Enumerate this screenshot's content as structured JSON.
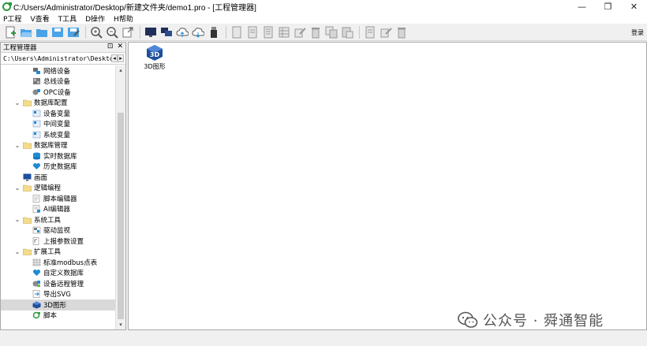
{
  "window": {
    "title": "C:/Users/Administrator/Desktop/新建文件夹/demo1.pro - [工程管理器]",
    "controls": {
      "minimize": "—",
      "maximize": "❐",
      "close": "✕"
    }
  },
  "menu": [
    "P工程",
    "V查看",
    "T工具",
    "D操作",
    "H帮助"
  ],
  "toolbar": {
    "groups": [
      [
        "new-file-icon",
        "open-folder-icon",
        "folder-icon",
        "save-icon",
        "save-as-icon"
      ],
      [
        "zoom-in-icon",
        "zoom-out-icon",
        "export-icon"
      ],
      [
        "monitor-icon",
        "multi-monitor-icon",
        "cloud-upload-icon",
        "cloud-download-icon",
        "usb-icon"
      ],
      [
        "doc-icon",
        "doc-add-icon",
        "list-icon",
        "table-icon",
        "edit-icon",
        "delete-icon",
        "copy-icon",
        "paste-icon"
      ],
      [
        "page-icon",
        "pen-icon",
        "trash-icon"
      ]
    ],
    "login_label": "登录"
  },
  "panel": {
    "title": "工程管理器",
    "pin_glyph": "⊡",
    "close_glyph": "✕",
    "path": "C:\\Users\\Administrator\\Desktop\\新建",
    "tree": [
      {
        "label": "网络设备",
        "level": 2,
        "icon": "network-device-icon",
        "toggle": ""
      },
      {
        "label": "总线设备",
        "level": 2,
        "icon": "bus-device-icon",
        "toggle": ""
      },
      {
        "label": "OPC设备",
        "level": 2,
        "icon": "opc-device-icon",
        "toggle": ""
      },
      {
        "label": "数据库配置",
        "level": 1,
        "icon": "folder-icon",
        "toggle": "⌄"
      },
      {
        "label": "设备变量",
        "level": 2,
        "icon": "variable-icon",
        "toggle": ""
      },
      {
        "label": "中间变量",
        "level": 2,
        "icon": "variable-icon",
        "toggle": ""
      },
      {
        "label": "系统变量",
        "level": 2,
        "icon": "variable-icon",
        "toggle": ""
      },
      {
        "label": "数据库管理",
        "level": 1,
        "icon": "folder-icon",
        "toggle": "⌄"
      },
      {
        "label": "实时数据库",
        "level": 2,
        "icon": "database-icon",
        "toggle": ""
      },
      {
        "label": "历史数据库",
        "level": 2,
        "icon": "history-db-icon",
        "toggle": ""
      },
      {
        "label": "画面",
        "level": 1,
        "icon": "screen-icon",
        "toggle": ""
      },
      {
        "label": "逻辑编程",
        "level": 1,
        "icon": "folder-icon",
        "toggle": "⌄"
      },
      {
        "label": "脚本编辑器",
        "level": 2,
        "icon": "script-editor-icon",
        "toggle": ""
      },
      {
        "label": "AI编辑器",
        "level": 2,
        "icon": "ai-editor-icon",
        "toggle": ""
      },
      {
        "label": "系统工具",
        "level": 1,
        "icon": "folder-icon",
        "toggle": "⌄"
      },
      {
        "label": "驱动监视",
        "level": 2,
        "icon": "driver-monitor-icon",
        "toggle": ""
      },
      {
        "label": "上报参数设置",
        "level": 2,
        "icon": "report-settings-icon",
        "toggle": ""
      },
      {
        "label": "扩展工具",
        "level": 1,
        "icon": "folder-icon",
        "toggle": "⌄"
      },
      {
        "label": "标准modbus点表",
        "level": 2,
        "icon": "grid-table-icon",
        "toggle": ""
      },
      {
        "label": "自定义数据库",
        "level": 2,
        "icon": "custom-db-icon",
        "toggle": ""
      },
      {
        "label": "设备远程管理",
        "level": 2,
        "icon": "remote-manage-icon",
        "toggle": ""
      },
      {
        "label": "导出SVG",
        "level": 2,
        "icon": "export-svg-icon",
        "toggle": ""
      },
      {
        "label": "3D图形",
        "level": 2,
        "icon": "3d-graphics-icon",
        "toggle": "",
        "selected": true
      },
      {
        "label": "脚本",
        "level": 2,
        "icon": "script-icon",
        "toggle": ""
      }
    ]
  },
  "main": {
    "item": {
      "label": "3D图形",
      "icon": "3d-graphics-icon"
    }
  },
  "watermark": {
    "text": "公众号 · 舜通智能"
  },
  "colors": {
    "accent": "#1e8bd6",
    "selection": "#d9d9d9",
    "folder": "#e9d28a"
  }
}
